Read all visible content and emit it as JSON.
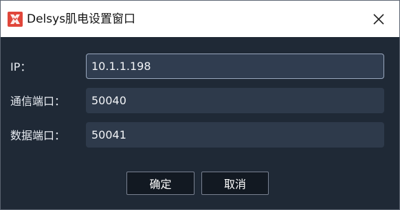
{
  "window": {
    "title": "Delsys肌电设置窗口",
    "icon": "delsys-logo-icon",
    "accent_color": "#e0463a"
  },
  "fields": [
    {
      "label": "IP：",
      "value": "10.1.1.198"
    },
    {
      "label": "通信端口：",
      "value": "50040"
    },
    {
      "label": "数据端口：",
      "value": "50041"
    }
  ],
  "buttons": {
    "ok_label": "确定",
    "cancel_label": "取消"
  }
}
